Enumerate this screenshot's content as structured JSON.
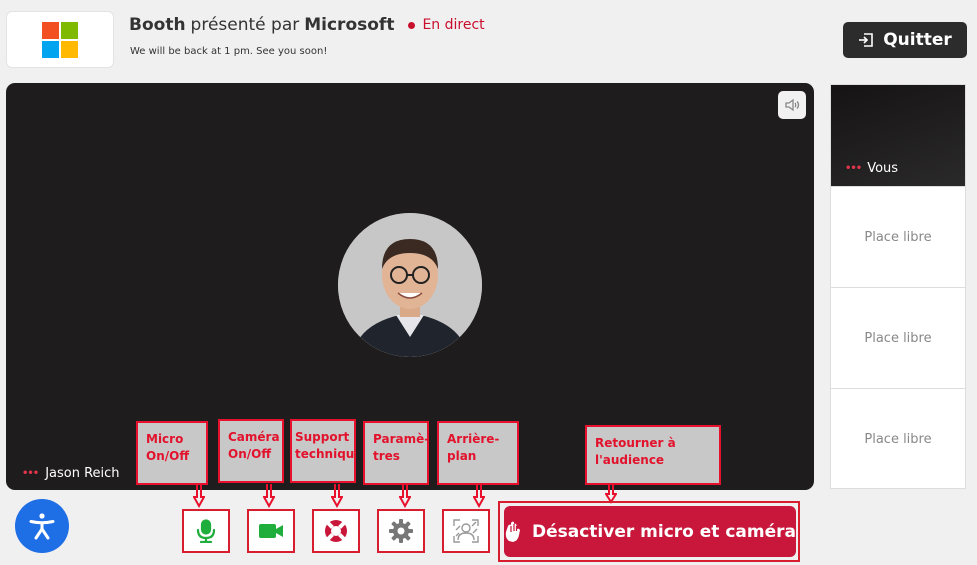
{
  "header": {
    "booth_word": "Booth",
    "presented_by": "présenté par",
    "company": "Microsoft",
    "live_label": "En direct",
    "subtitle": "We will be back at 1 pm. See you soon!",
    "quit_label": "Quitter"
  },
  "colors": {
    "accent": "#c8173a",
    "annotation": "#e8112d",
    "ms_red": "#f25022",
    "ms_green": "#7fba00",
    "ms_blue": "#00a4ef",
    "ms_yellow": "#ffb900"
  },
  "stage": {
    "speaker_name": "Jason Reich",
    "volume_icon": "speaker-icon"
  },
  "side": {
    "self_label": "Vous",
    "slots": [
      "Place libre",
      "Place libre",
      "Place libre"
    ]
  },
  "controls": {
    "leave_label": "Désactiver micro et caméra",
    "icons": [
      "microphone-icon",
      "camera-icon",
      "lifebuoy-icon",
      "gear-icon",
      "background-icon",
      "raised-hand-icon",
      "accessibility-icon"
    ]
  },
  "annotations": {
    "mic": [
      "Micro",
      "On/Off"
    ],
    "camera": [
      "Caméra",
      "On/Off"
    ],
    "support": [
      "Support",
      "technique"
    ],
    "settings": [
      "Paramè-",
      "tres"
    ],
    "background": [
      "Arrière-",
      "plan"
    ],
    "leave": [
      "Retourner à",
      "l'audience"
    ]
  }
}
